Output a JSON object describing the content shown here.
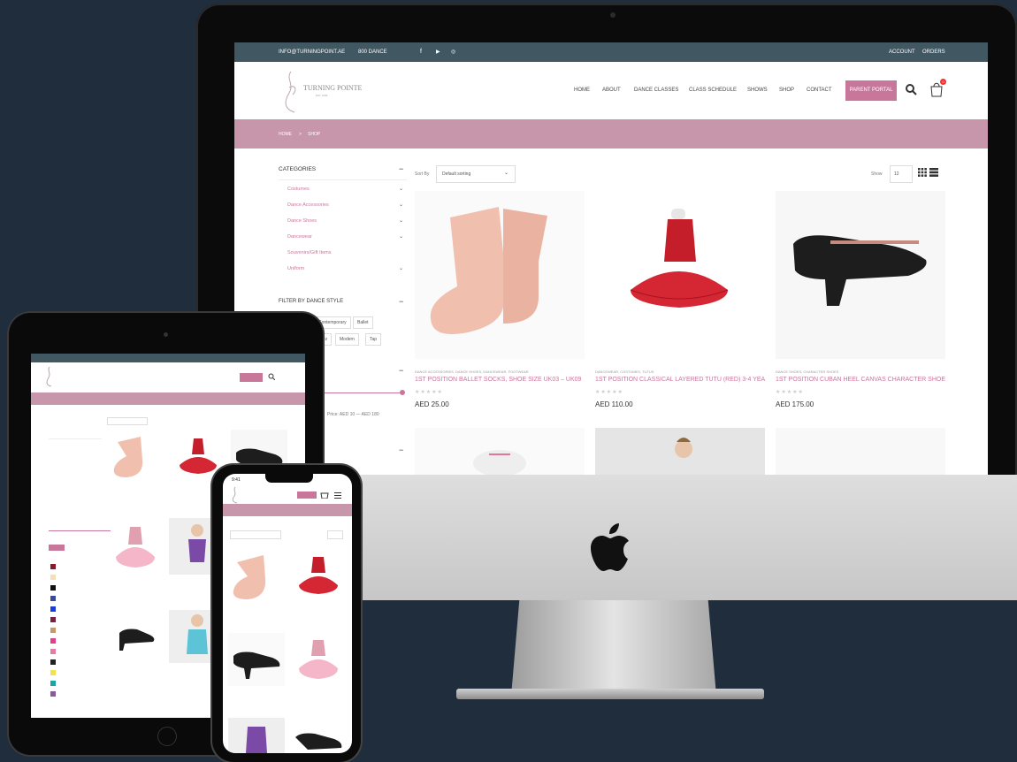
{
  "topbar": {
    "email": "INFO@TURNINGPOINT.AE",
    "phone": "800 DANCE",
    "social": [
      "f",
      "▶",
      "◎"
    ],
    "account": "ACCOUNT",
    "orders": "ORDERS"
  },
  "brand": {
    "name": "TURNING POINTE",
    "sub": "EST 1998"
  },
  "nav": [
    "HOME",
    "ABOUT",
    "DANCE CLASSES",
    "CLASS SCHEDULE",
    "SHOWS",
    "SHOP",
    "CONTACT"
  ],
  "parent_portal": "PARENT PORTAL",
  "cart_count": "0",
  "breadcrumb": {
    "home": "HOME",
    "sep": ">",
    "current": "SHOP"
  },
  "sidebar": {
    "categories_title": "CATEGORIES",
    "categories": [
      "Costumes",
      "Dance Accessories",
      "Dance Shoes",
      "Dancewear",
      "Souvenirs/Gift Items",
      "Uniform"
    ],
    "filter_style_title": "FILTER BY DANCE STYLE",
    "styles": [
      "Contemporary",
      "Ballet",
      "Jazz",
      "Modern",
      "Tap"
    ],
    "price_text": "Price: AED 10 — AED 180"
  },
  "toolbar": {
    "sort_label": "Sort By",
    "sort_value": "Default sorting",
    "show_label": "Show",
    "show_value": "12"
  },
  "products": [
    {
      "category": "DANCE ACCESSORIES, DANCE SHOES, DANCEWEAR, FOOTWEAR",
      "name": "1ST POSITION BALLET SOCKS, SHOE SIZE UK03 – UK09",
      "price": "AED 25.00"
    },
    {
      "category": "DANCEWEAR, COSTUMES, TUTUS",
      "name": "1ST POSITION CLASSICAL LAYERED TUTU (RED) 3-4 YEA...",
      "price": "AED 110.00"
    },
    {
      "category": "DANCE SHOES, CHARACTER SHOES",
      "name": "1ST POSITION CUBAN HEEL CANVAS CHARACTER SHOES",
      "price": "AED 175.00"
    }
  ],
  "stars": "★★★★★",
  "phone_time": "9:41",
  "colors": {
    "accent": "#c8779b",
    "topbar": "#415761",
    "breadcrumb": "#c796ab",
    "bg": "#1f2d3d"
  },
  "icons": [
    "search-icon",
    "cart-icon",
    "grid-icon",
    "list-icon",
    "chevron-down-icon",
    "apple-logo-icon",
    "menu-icon"
  ]
}
